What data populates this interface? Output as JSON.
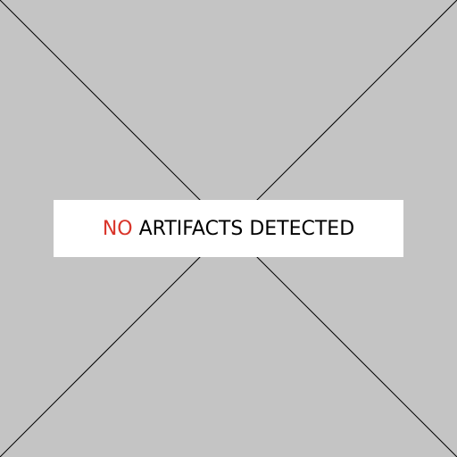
{
  "placeholder": {
    "status_prefix": "NO",
    "status_suffix": "ARTIFACTS DETECTED"
  },
  "colors": {
    "background": "#c4c4c4",
    "banner": "#ffffff",
    "highlight": "#d9352a",
    "text": "#000000",
    "lines": "#000000"
  }
}
